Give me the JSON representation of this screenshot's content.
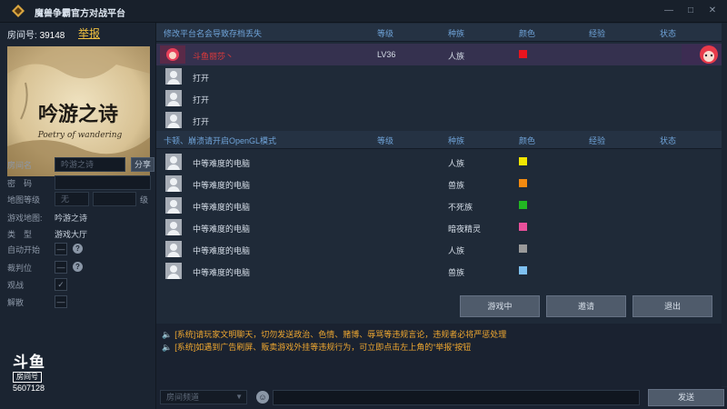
{
  "window": {
    "title": "魔兽争霸官方对战平台",
    "controls": [
      "—",
      "□",
      "✕"
    ]
  },
  "left": {
    "room_label": "房间号:",
    "room_number": "39148",
    "report_label": "举报",
    "map_title_art": "吟游之诗",
    "map_subtitle_art": "Poetry of wandering",
    "fields": {
      "room_name_label": "房间名",
      "room_name_placeholder": "吟游之诗",
      "share_label": "分享",
      "password_label": "密　码",
      "map_level_label": "地图等级",
      "map_level_value": "无",
      "map_level_unit": "级",
      "game_map_label": "游戏地图:",
      "game_map_value": "吟游之诗",
      "type_label": "类　型",
      "type_value": "游戏大厅",
      "auto_start_label": "自动开始",
      "auto_start_value": "—",
      "referee_label": "裁判位",
      "referee_value": "—",
      "spectate_label": "观战",
      "spectate_value": "✓",
      "dissolve_label": "解散",
      "dissolve_value": "—"
    },
    "watermark": {
      "logo": "斗鱼",
      "tag": "房间号",
      "room_id": "5607128"
    }
  },
  "team1": {
    "name": "修改平台名会导致存档丢失",
    "headers": {
      "level": "等级",
      "race": "种族",
      "color": "颜色",
      "exp": "经验",
      "status": "状态"
    },
    "rows": [
      {
        "name": "斗鱼丽莎丶",
        "level": "LV36",
        "race": "人族",
        "color": "#e8141e"
      },
      {
        "name": "打开",
        "level": "",
        "race": "",
        "color": ""
      },
      {
        "name": "打开",
        "level": "",
        "race": "",
        "color": ""
      },
      {
        "name": "打开",
        "level": "",
        "race": "",
        "color": ""
      }
    ]
  },
  "team2": {
    "name": "卡顿、崩溃请开启OpenGL模式",
    "headers": {
      "level": "等级",
      "race": "种族",
      "color": "颜色",
      "exp": "经验",
      "status": "状态"
    },
    "rows": [
      {
        "name": "中等难度的电脑",
        "race": "人族",
        "color": "#f2e600"
      },
      {
        "name": "中等难度的电脑",
        "race": "兽族",
        "color": "#f28a10"
      },
      {
        "name": "中等难度的电脑",
        "race": "不死族",
        "color": "#22b822"
      },
      {
        "name": "中等难度的电脑",
        "race": "暗夜精灵",
        "color": "#e8509a"
      },
      {
        "name": "中等难度的电脑",
        "race": "人族",
        "color": "#9a9a9a"
      },
      {
        "name": "中等难度的电脑",
        "race": "兽族",
        "color": "#7ec0f0"
      }
    ]
  },
  "actions": {
    "in_game": "游戏中",
    "invite": "邀请",
    "exit": "退出"
  },
  "messages": [
    "[系统]请玩家文明聊天，切勿发送政治、色情、赌博、辱骂等违规言论，违规者必将严惩处理",
    "[系统]如遇到广告刷屏、贩卖游戏外挂等违规行为，可立即点击左上角的“举报”按钮"
  ],
  "chat": {
    "channel_placeholder": "房间频道",
    "send_label": "发送"
  }
}
